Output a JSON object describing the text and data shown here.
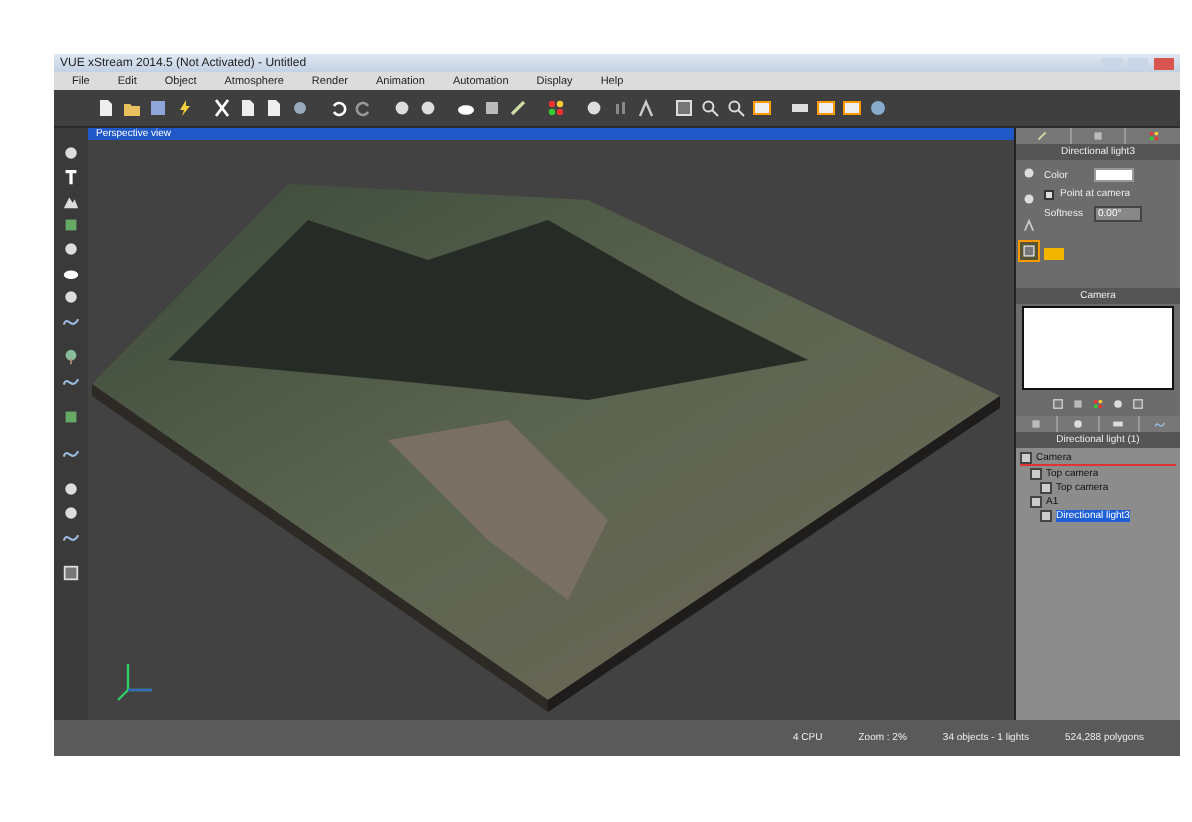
{
  "window": {
    "title": "VUE xStream 2014.5 (Not Activated) - Untitled"
  },
  "menu": [
    "File",
    "Edit",
    "Object",
    "Atmosphere",
    "Render",
    "Animation",
    "Automation",
    "Display",
    "Help"
  ],
  "viewport": {
    "title": "Perspective view"
  },
  "light_panel": {
    "title": "Directional light3",
    "color_label": "Color",
    "point_at_camera": {
      "label": "Point at camera",
      "checked": false
    },
    "softness": {
      "label": "Softness",
      "value": "0.00°"
    }
  },
  "camera_panel": {
    "title": "Camera"
  },
  "world_browser": {
    "title": "Directional light (1)",
    "items": [
      {
        "label": "Camera",
        "selected": false,
        "children": [
          {
            "label": "Top camera",
            "selected": false,
            "children": [
              {
                "label": "Top camera",
                "selected": false
              }
            ]
          },
          {
            "label": "A1",
            "selected": false,
            "children": [
              {
                "label": "Directional light3",
                "selected": true
              }
            ]
          }
        ]
      }
    ]
  },
  "status_bar": [
    "4 CPU",
    "Zoom : 2%",
    "34 objects - 1 lights",
    "524,288 polygons"
  ]
}
